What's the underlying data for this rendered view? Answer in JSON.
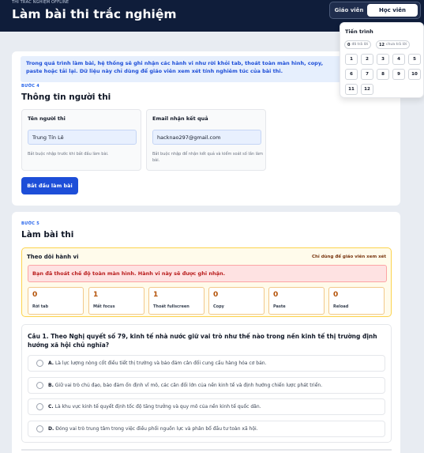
{
  "header": {
    "eyebrow": "THI TRẮC NGHIỆM OFFLINE",
    "title": "Làm bài thi trắc nghiệm",
    "roles": {
      "teacher": "Giáo viên",
      "student": "Học viên",
      "active": "student"
    }
  },
  "notice": "Trong quá trình làm bài, hệ thống sẽ ghi nhận các hành vi như rời khỏi tab, thoát toàn màn hình, copy, paste hoặc tải lại. Dữ liệu này chỉ dùng để giáo viên xem xét tính nghiêm túc của bài thi.",
  "step4": {
    "step_label": "BƯỚC 4",
    "title": "Thông tin người thi",
    "name": {
      "label": "Tên người thi",
      "value": "Trung Tín Lê",
      "help": "Bắt buộc nhập trước khi bắt đầu làm bài."
    },
    "email": {
      "label": "Email nhận kết quả",
      "value": "hacknao297@gmail.com",
      "help": "Bắt buộc nhập để nhận kết quả và kiểm soát số lần làm bài."
    },
    "start_label": "Bắt đầu làm bài"
  },
  "step5": {
    "step_label": "BƯỚC 5",
    "title": "Làm bài thi",
    "monitor": {
      "title": "Theo dõi hành vi",
      "note": "Chỉ dùng để giáo viên xem xét",
      "alert": "Bạn đã thoát chế độ toàn màn hình. Hành vi này sẽ được ghi nhận.",
      "stats": [
        {
          "value": "0",
          "label": "Rời tab"
        },
        {
          "value": "1",
          "label": "Mất focus"
        },
        {
          "value": "1",
          "label": "Thoát fullscreen"
        },
        {
          "value": "0",
          "label": "Copy"
        },
        {
          "value": "0",
          "label": "Paste"
        },
        {
          "value": "0",
          "label": "Reload"
        }
      ]
    },
    "question": {
      "text": "Câu 1. Theo Nghị quyết số 79, kinh tế nhà nước giữ vai trò như thế nào trong nền kinh tế thị trường định hướng xã hội chủ nghĩa?",
      "options": [
        {
          "key": "A.",
          "text": "Là lực lượng nòng cốt điều tiết thị trường và bảo đảm cân đối cung cầu hàng hóa cơ bản."
        },
        {
          "key": "B.",
          "text": "Giữ vai trò chủ đạo, bảo đảm ổn định vĩ mô, các cân đối lớn của nền kinh tế và định hướng chiến lược phát triển."
        },
        {
          "key": "C.",
          "text": "Là khu vực kinh tế quyết định tốc độ tăng trưởng và quy mô của nền kinh tế quốc dân."
        },
        {
          "key": "D.",
          "text": "Đóng vai trò trung tâm trong việc điều phối nguồn lực và phân bổ đầu tư toàn xã hội."
        }
      ]
    }
  },
  "progress": {
    "title": "Tiến trình",
    "answered_count": "0",
    "answered_label": "đã trả lời",
    "unanswered_count": "12",
    "unanswered_label": "chưa trả lời",
    "numbers": [
      "1",
      "2",
      "3",
      "4",
      "5",
      "6",
      "7",
      "8",
      "9",
      "10",
      "11",
      "12"
    ]
  }
}
